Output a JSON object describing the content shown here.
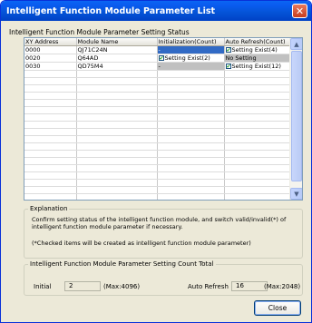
{
  "window": {
    "title": "Intelligent Function Module Parameter List"
  },
  "status_section_label": "Intelligent Function Module Parameter Setting Status",
  "table": {
    "headers": [
      "XY Address",
      "Module Name",
      "Initialization(Count)",
      "Auto Refresh(Count)"
    ],
    "rows": [
      {
        "xy": "0000",
        "module": "QJ71C24N",
        "init": "-",
        "init_checked": false,
        "refresh": "Setting Exist(4)",
        "refresh_checked": true
      },
      {
        "xy": "0020",
        "module": "Q64AD",
        "init": "Setting Exist(2)",
        "init_checked": true,
        "refresh": "No Setting",
        "refresh_checked": false
      },
      {
        "xy": "0030",
        "module": "QD75M4",
        "init": "-",
        "init_checked": false,
        "refresh": "Setting Exist(12)",
        "refresh_checked": true
      }
    ]
  },
  "explanation": {
    "legend": "Explanation",
    "line1": "Confirm setting status of the intelligent function module, and switch valid/invalid(*) of",
    "line2": "intelligent function module parameter if necessary.",
    "line3": "(*Checked items will be created as intelligent function module parameter)"
  },
  "count_total": {
    "legend": "Intelligent Function Module Parameter Setting Count Total",
    "initial_label": "Initial",
    "initial_value": "2",
    "initial_max": "(Max:4096)",
    "refresh_label": "Auto Refresh",
    "refresh_value": "16",
    "refresh_max": "(Max:2048)"
  },
  "buttons": {
    "close": "Close"
  },
  "icons": {
    "title_close": "close-icon",
    "scroll_up": "chevron-up-icon",
    "scroll_down": "chevron-down-icon",
    "check": "checkmark-icon"
  },
  "colors": {
    "titlebar": "#0453d6",
    "selection": "#316ac5",
    "disabled_cell": "#c0c0c0",
    "dialog_bg": "#ece9d8"
  }
}
